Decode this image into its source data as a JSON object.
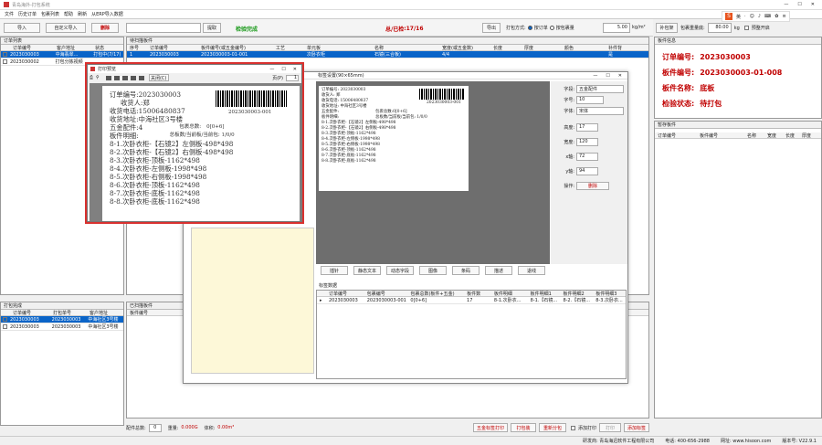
{
  "window": {
    "title": "青岛海外-打包系统"
  },
  "menu": [
    "文件",
    "历史订单",
    "包裹列表",
    "帮助",
    "刷新",
    "从ERP导入数据"
  ],
  "toolbar": {
    "import": "导入",
    "custom_import": "自定义导入",
    "delete": "删除",
    "confirm": "提取",
    "scan_status": "检验完成",
    "total_label": "总/已检",
    "total_value": "17/16",
    "export": "导出",
    "pack_mode_label": "打包方式:",
    "mode_a": "按订单",
    "mode_b": "按包裹量",
    "weight_value": "5.00",
    "weight_unit": "kg/m²",
    "extend_btn": "补包架",
    "weight_label": "包裹重量底:",
    "weight2": "80.00",
    "weight2_unit": "kg",
    "auto_open": "预整开启"
  },
  "order_list": {
    "title": "订单列表",
    "cols": [
      "订单编号",
      "客户地址",
      "状态"
    ],
    "rows": [
      {
        "id": "2023030003",
        "addr": "中海翡翠...",
        "status": "打包中(7/17)",
        "checked": true,
        "selected": true
      },
      {
        "id": "2023030002",
        "addr": "打包分拣视频",
        "status": "",
        "checked": false,
        "selected": false
      }
    ]
  },
  "board_list": {
    "title": "待扫描板件",
    "cols": [
      "序号",
      "订单编号",
      "板件编号(或五金编号)",
      "工艺",
      "单元板",
      "名称",
      "宽度(或五金数)",
      "长度",
      "厚度",
      "颜色",
      "补件背"
    ],
    "rows": [
      {
        "no": "1",
        "order": "2023030003",
        "board": "2023030003-01-001",
        "proc": "",
        "unit": "次卧衣柜",
        "name": "石镜(三合板)",
        "w": "4/4",
        "l": "",
        "t": "",
        "color": "",
        "mark": "是"
      }
    ]
  },
  "packed": {
    "title": "打包完成",
    "cols": [
      "订单编号",
      "打包单号",
      "客户地址"
    ],
    "rows": [
      {
        "order": "2023030003",
        "pack": "2023030003",
        "addr": "中海社区3号楼",
        "selected": true
      },
      {
        "order": "2023030003",
        "pack": "2023030003",
        "addr": "中海社区3号楼",
        "selected": false
      }
    ]
  },
  "scanned": {
    "title": "已扫描板件",
    "col": "板件编号"
  },
  "board_info": {
    "title": "板件信息",
    "items": [
      {
        "label": "订单编号:",
        "value": "2023030003"
      },
      {
        "label": "板件编号:",
        "value": "2023030003-01-008"
      },
      {
        "label": "板件名称:",
        "value": "底板"
      },
      {
        "label": "检验状态:",
        "value": "待打包"
      }
    ]
  },
  "temp_board": {
    "title": "暂存板件",
    "cols": [
      "订单编号",
      "板件编号",
      "名称",
      "宽度",
      "长度",
      "厚度"
    ]
  },
  "print_preview": {
    "title": "打印预览",
    "close": "关闭(C)",
    "page_label": "页(P)",
    "page_value": "1",
    "order_line": "订单编号:2023030003",
    "barcode_text": "2023030003-001",
    "receiver": "收货人:郑",
    "phone": "收货电话:15006480837",
    "address": "收货地址:中海社区3号楼",
    "hardware": "五金配件:4",
    "pkg_total_label": "包裹总数:",
    "pkg_total_value": "0[0+6]",
    "board_detail": "板件明细:",
    "board_detail_right": "总板数/当前板/当前包: 1/0/0",
    "lines": [
      "8-1.次卧衣柜-【石镜2】左侧板-498*498",
      "8-2.次卧衣柜-【石镜2】右侧板-498*498",
      "8-3.次卧衣柜-顶板-1162*498",
      "8-4.次卧衣柜-左侧板-1998*498",
      "8-5.次卧衣柜-右侧板-1998*498",
      "8-6.次卧衣柜-顶板-1162*498",
      "8-7.次卧衣柜-底板-1162*498",
      "8-8.次卧衣柜-底板-1162*498"
    ]
  },
  "label_designer": {
    "title": "标签设置(90×65mm)",
    "tabs": [
      "插针",
      "静态文本",
      "动态字段",
      "图像",
      "条码",
      "描述",
      "退线"
    ],
    "preview": {
      "order": "订单编号: 2023030003",
      "receiver": "收货人: 郑",
      "phone": "收货电话: 15006480837",
      "addr": "收货地址: 中海社区3号楼",
      "hw": "五金配件:",
      "pkg": "包裹总数:",
      "pkg_val": "0[0+6]",
      "detail": "板件明细:",
      "detail_r": "总板数/当前板/当前包: 1/0/0",
      "barcode": "2023030003-001",
      "lines": [
        "8-1.次卧衣柜-【石镜2】左侧板-498*498",
        "8-2.次卧衣柜-【石镜2】右侧板-498*498",
        "8-3.次卧衣柜-顶板-1162*498",
        "8-4.次卧衣柜-左侧板-1998*498",
        "8-5.次卧衣柜-右侧板-1998*498",
        "8-6.次卧衣柜-顶板-1162*498",
        "8-7.次卧衣柜-底板-1162*498",
        "8-8.次卧衣柜-底板-1162*498"
      ]
    },
    "props": [
      {
        "label": "字段:",
        "value": "五金配件"
      },
      {
        "label": "字号:",
        "value": "10"
      },
      {
        "label": "字体:",
        "value": "宋体"
      },
      {
        "label": "高度:",
        "value": "17"
      },
      {
        "label": "宽度:",
        "value": "120"
      },
      {
        "label": "x轴:",
        "value": "72"
      },
      {
        "label": "y轴:",
        "value": "94"
      }
    ],
    "op_label": "操作:",
    "op_btn": "删除",
    "data_title": "标签数据",
    "data_cols": [
      "订单编号",
      "包裹编号",
      "包裹总数(板件+五金)",
      "板件数",
      "板件明细",
      "板件明细1",
      "板件明细2",
      "板件明细3"
    ],
    "data_row": [
      "2023030003",
      "2023030003-001",
      "0[0+6]",
      "17",
      "8-1.次卧衣...",
      "8-1.【石镜...",
      "8-2.【石镜...",
      "8-3.次卧衣..."
    ]
  },
  "bottom": {
    "hw_label": "配件总数:",
    "hw_value": "0",
    "weight_label": "重量:",
    "weight_value": "0.000G",
    "volume_label": "体积:",
    "volume_value": "0.00m³",
    "btn_print_hw": "五金标签打印",
    "btn_wrap": "打包装",
    "btn_repack": "重新分包",
    "cb_label": "添加打印",
    "btn_print": "打印",
    "btn_add_label": "添加标签"
  },
  "status": {
    "company": "研发商: 青岛海迅软件工程有限公司",
    "phone": "电话: 400-656-2988",
    "site": "网址: www.hisoon.com",
    "version": "版本号: V22.9.1"
  },
  "colors": {
    "accent": "#0a64c8",
    "highlight": "#d9312f",
    "green": "#1a9a1a",
    "red": "#c00000"
  }
}
